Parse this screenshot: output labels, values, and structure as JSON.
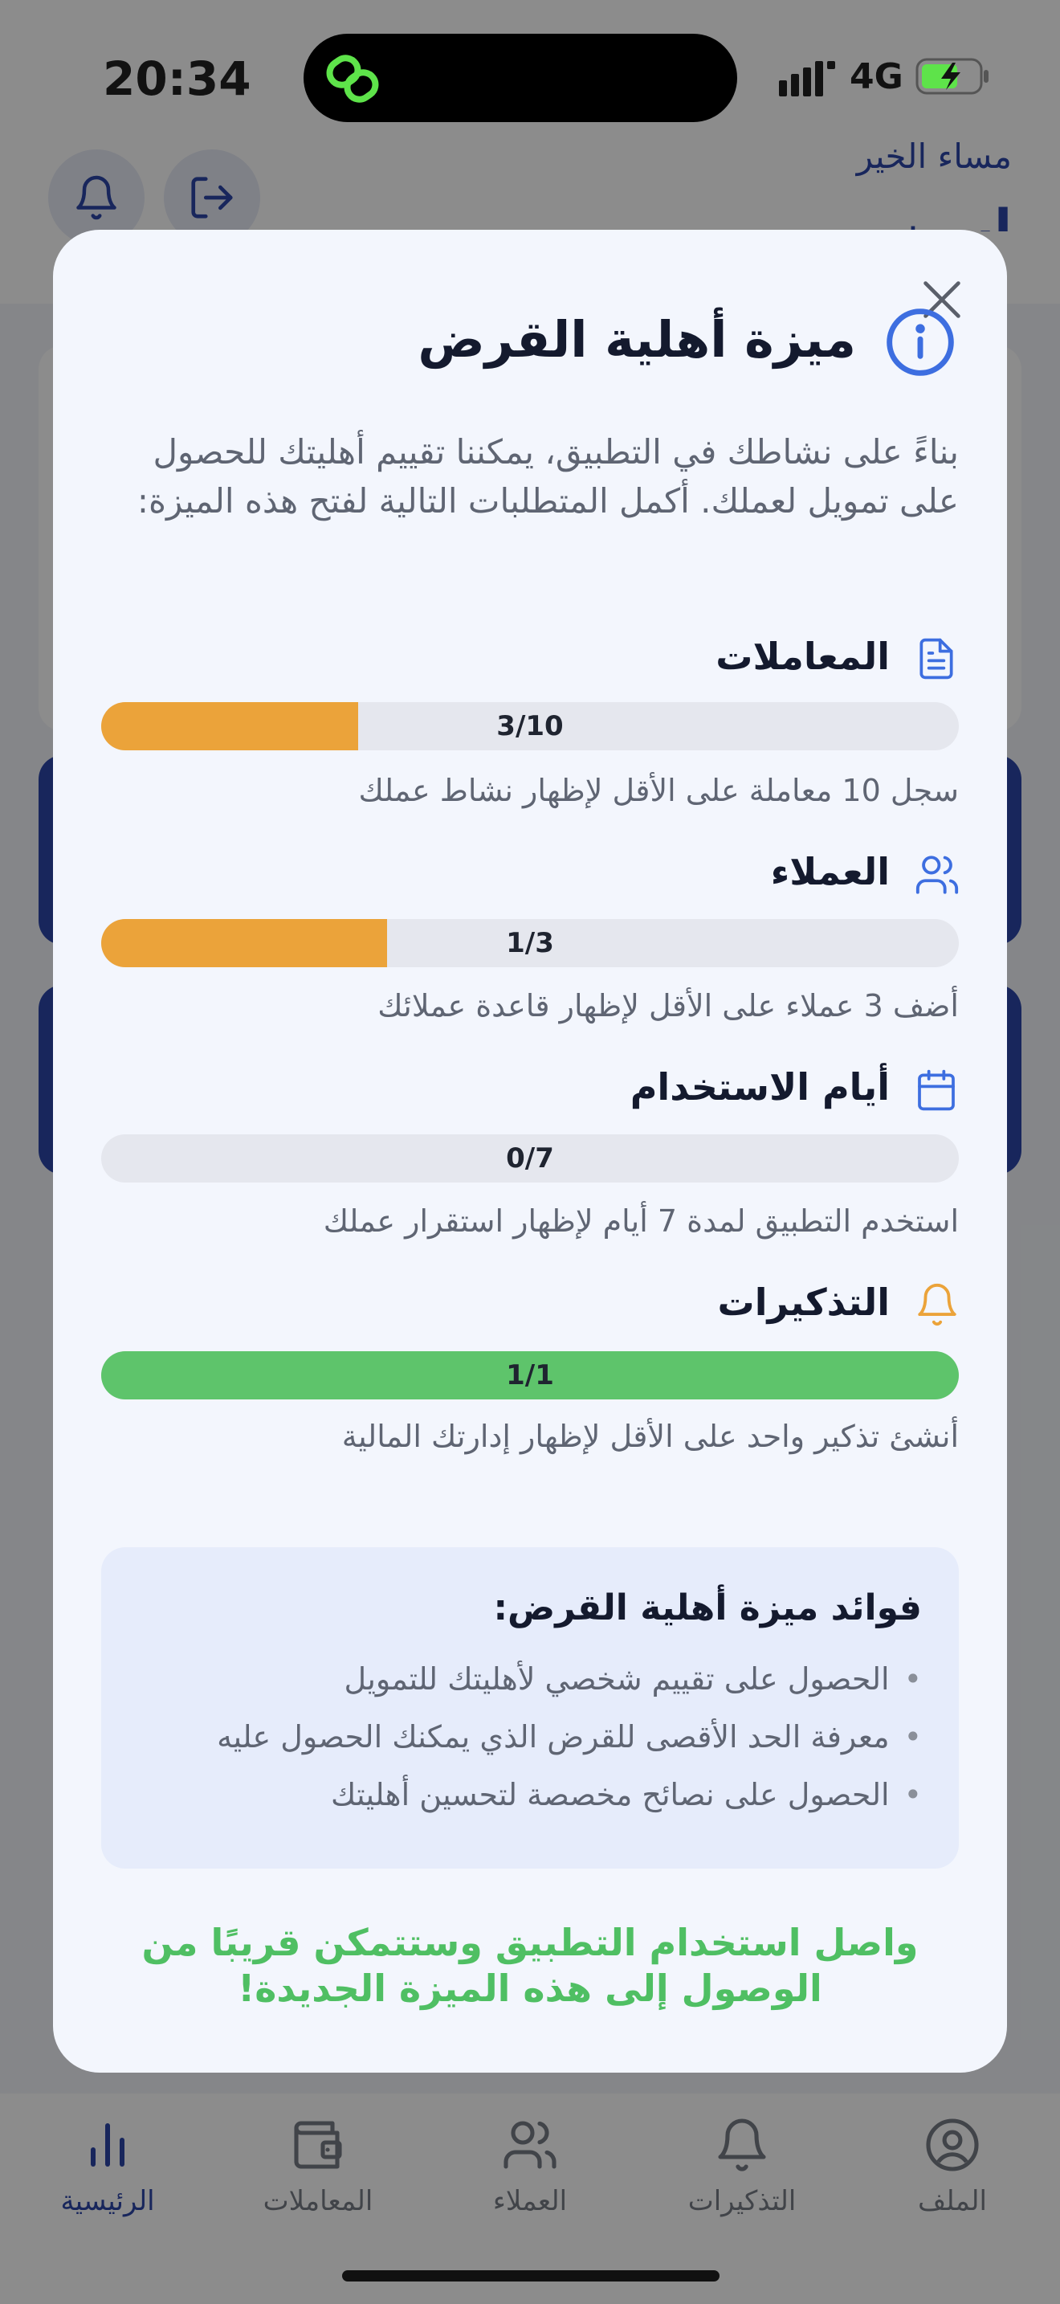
{
  "status_bar": {
    "time": "20:34",
    "network": "4G"
  },
  "header": {
    "greeting": "مساء الخير",
    "user_name": "ايمن"
  },
  "modal": {
    "title": "ميزة أهلية القرض",
    "intro": "بناءً على نشاطك في التطبيق، يمكننا تقييم أهليتك للحصول على تمويل لعملك. أكمل المتطلبات التالية لفتح هذه الميزة:",
    "requirements": [
      {
        "title": "المعاملات",
        "icon": "document-icon",
        "progress_label": "3/10",
        "current": 3,
        "target": 10,
        "color": "#eba33a",
        "description": "سجل 10 معاملة على الأقل لإظهار نشاط عملك"
      },
      {
        "title": "العملاء",
        "icon": "users-icon",
        "progress_label": "1/3",
        "current": 1,
        "target": 3,
        "color": "#eba33a",
        "description": "أضف 3 عملاء على الأقل لإظهار قاعدة عملائك"
      },
      {
        "title": "أيام الاستخدام",
        "icon": "calendar-icon",
        "progress_label": "0/7",
        "current": 0,
        "target": 7,
        "color": "#eba33a",
        "description": "استخدم التطبيق لمدة 7 أيام لإظهار استقرار عملك"
      },
      {
        "title": "التذكيرات",
        "icon": "bell-icon",
        "progress_label": "1/1",
        "current": 1,
        "target": 1,
        "color": "#5ec46b",
        "description": "أنشئ تذكير واحد على الأقل لإظهار إدارتك المالية"
      }
    ],
    "benefits_title": "فوائد ميزة أهلية القرض:",
    "benefits": [
      "الحصول على تقييم شخصي لأهليتك للتمويل",
      "معرفة الحد الأقصى للقرض الذي يمكنك الحصول عليه",
      "الحصول على نصائح مخصصة لتحسين أهليتك"
    ],
    "closing_message": "واصل استخدام التطبيق وستتمكن قريبًا من الوصول إلى هذه الميزة الجديدة!"
  },
  "nav": [
    {
      "label": "الرئيسية",
      "icon": "chart-icon",
      "active": true
    },
    {
      "label": "المعاملات",
      "icon": "wallet-icon",
      "active": false
    },
    {
      "label": "العملاء",
      "icon": "users-icon",
      "active": false
    },
    {
      "label": "التذكيرات",
      "icon": "bell-icon",
      "active": false
    },
    {
      "label": "الملف",
      "icon": "profile-icon",
      "active": false
    }
  ],
  "colors": {
    "primary": "#2c46a8",
    "orange": "#eba33a",
    "green": "#5ec46b",
    "info_blue": "#3d6ee0"
  }
}
